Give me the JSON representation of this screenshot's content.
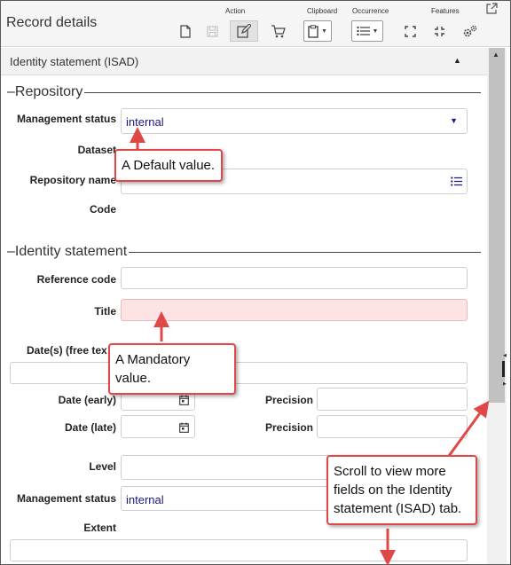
{
  "header": {
    "title": "Record details",
    "groups": {
      "action": "Action",
      "clipboard": "Clipboard",
      "occurrence": "Occurrence",
      "features": "Features"
    },
    "icons": [
      "new-document-icon",
      "save-icon",
      "edit-icon",
      "cart-icon",
      "clipboard-icon",
      "list-icon",
      "expand-icon",
      "collapse-icon",
      "settings-icon",
      "popout-icon"
    ]
  },
  "section": {
    "title": "Identity statement (ISAD)"
  },
  "repository": {
    "legend": "Repository",
    "management_status_label": "Management status",
    "management_status_value": "internal",
    "dataset_label": "Dataset",
    "repository_name_label": "Repository name",
    "code_label": "Code"
  },
  "identity": {
    "legend": "Identity statement",
    "reference_code_label": "Reference code",
    "title_label": "Title",
    "dates_free_text_label": "Date(s) (free tex",
    "date_early_label": "Date (early)",
    "date_late_label": "Date (late)",
    "precision_label": "Precision",
    "level_label": "Level",
    "management_status_label": "Management status",
    "management_status_value": "internal",
    "extent_label": "Extent"
  },
  "callouts": {
    "default": "A Default value.",
    "mandatory": "A Mandatory value.",
    "scroll": "Scroll to view more fields on the Identity statement (ISAD) tab."
  },
  "colors": {
    "callout_border": "#e04848",
    "mandatory_fill": "#fde3e3",
    "value_text": "#1a1a80"
  }
}
